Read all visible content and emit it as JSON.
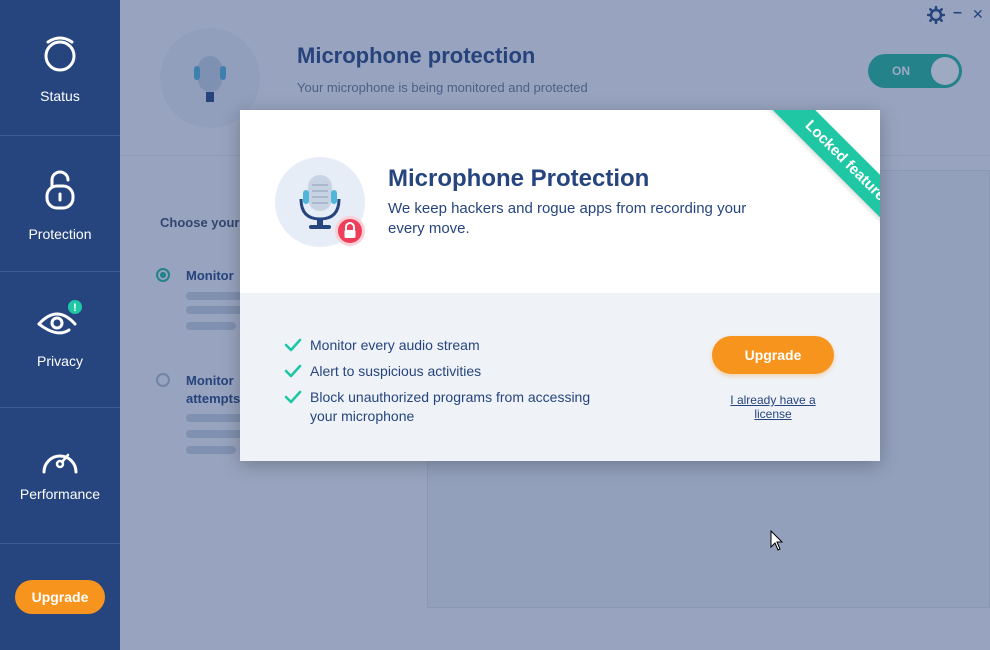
{
  "sidebar": {
    "items": [
      {
        "label": "Status",
        "icon": "status-ring-icon"
      },
      {
        "label": "Protection",
        "icon": "lock-icon"
      },
      {
        "label": "Privacy",
        "icon": "eye-icon",
        "badge": "!"
      },
      {
        "label": "Performance",
        "icon": "speedometer-icon"
      }
    ],
    "upgrade_label": "Upgrade"
  },
  "background": {
    "title": "Microphone protection",
    "subtitle": "Your microphone is being monitored and protected",
    "toggle_label": "ON",
    "choose_label": "Choose your",
    "option1": "Monitor",
    "option2": "Monitor",
    "option2_line2": "attempts"
  },
  "window": {
    "settings_icon": "gear-icon",
    "minimize": "–",
    "close": "✕"
  },
  "modal": {
    "ribbon": "Locked feature",
    "title": "Microphone Protection",
    "description": "We keep hackers and rogue apps from recording your every move.",
    "features": [
      "Monitor every audio stream",
      "Alert to suspicious activities",
      "Block unauthorized programs from accessing your microphone"
    ],
    "upgrade_label": "Upgrade",
    "license_link": "I already have a license"
  },
  "colors": {
    "sidebar": "#26457f",
    "accent_orange": "#f7941d",
    "accent_green": "#1fc7a5",
    "danger": "#ef3e5a"
  }
}
